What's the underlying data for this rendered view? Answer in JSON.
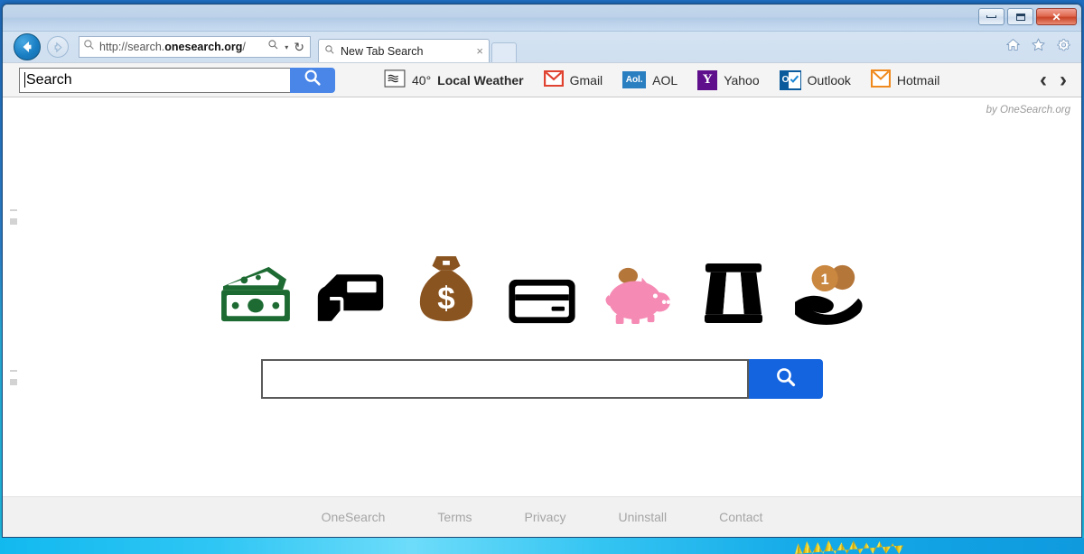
{
  "window": {
    "controls": {
      "minimize": "minimize",
      "maximize": "maximize",
      "close": "✕"
    }
  },
  "nav": {
    "back_label": "←",
    "forward_label": "→",
    "url_prefix": "http://search.",
    "url_domain": "onesearch.org",
    "url_suffix": "/",
    "search_dropdown": "▾",
    "refresh": "↻",
    "home_icon": "home-icon",
    "favorites_icon": "star-icon",
    "tools_icon": "gear-icon"
  },
  "tabs": [
    {
      "title": "New Tab Search",
      "close": "×"
    }
  ],
  "ext_toolbar": {
    "search_value": "Search",
    "search_placeholder": "Search",
    "search_button_icon": "search-icon",
    "links": [
      {
        "name": "local-weather",
        "icon": "weather-fog-icon",
        "temp": "40°",
        "label": "Local Weather"
      },
      {
        "name": "gmail",
        "icon": "gmail-envelope-icon",
        "label": "Gmail"
      },
      {
        "name": "aol",
        "icon": "aol-icon",
        "badge": "Aol.",
        "label": "AOL"
      },
      {
        "name": "yahoo",
        "icon": "yahoo-icon",
        "badge": "Y",
        "label": "Yahoo"
      },
      {
        "name": "outlook",
        "icon": "outlook-icon",
        "badge": "O",
        "label": "Outlook"
      },
      {
        "name": "hotmail",
        "icon": "hotmail-envelope-icon",
        "label": "Hotmail"
      }
    ],
    "prev_arrow": "‹",
    "next_arrow": "›"
  },
  "page": {
    "byline": "by OneSearch.org",
    "icons": [
      {
        "name": "cash-stack-icon",
        "color": "#1d6b32"
      },
      {
        "name": "hand-holding-card-icon",
        "color": "#000000"
      },
      {
        "name": "money-bag-icon",
        "color": "#8a5420"
      },
      {
        "name": "credit-card-icon",
        "color": "#000000"
      },
      {
        "name": "piggy-bank-icon",
        "color": "#f58bb4"
      },
      {
        "name": "money-clip-icon",
        "color": "#000000"
      },
      {
        "name": "hand-with-coins-icon",
        "color": "#000000"
      }
    ],
    "search_value": "",
    "search_placeholder": "",
    "search_button_icon": "search-icon"
  },
  "footer": {
    "links": [
      "OneSearch",
      "Terms",
      "Privacy",
      "Uninstall",
      "Contact"
    ]
  },
  "colors": {
    "accent_blue": "#1464e0",
    "toolbar_blue": "#4a86e8",
    "title_blue": "#1a7fc4",
    "footer_text": "#a5a5a5"
  }
}
